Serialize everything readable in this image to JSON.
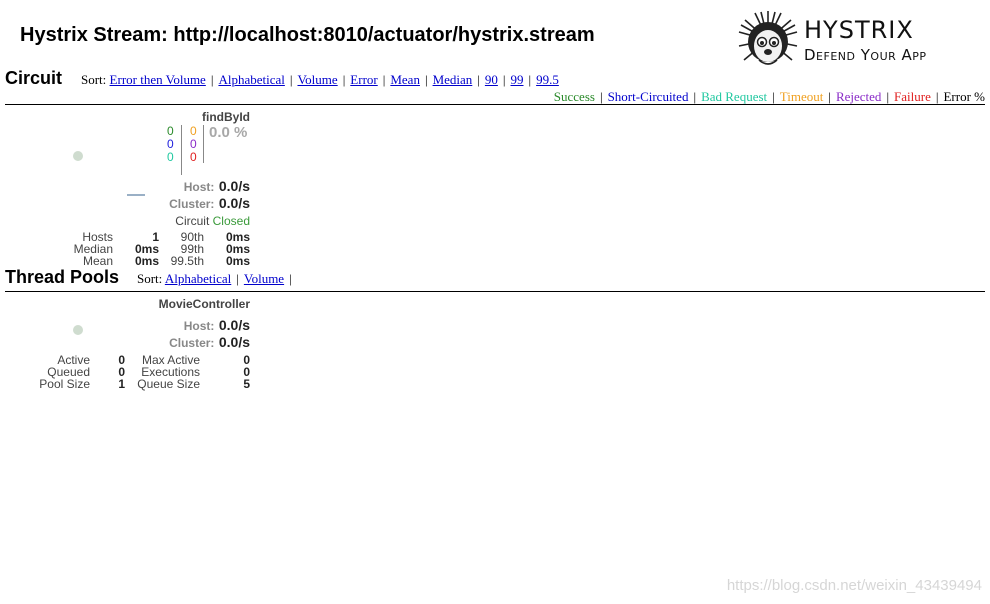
{
  "header": {
    "title": "Hystrix Stream: http://localhost:8010/actuator/hystrix.stream",
    "logo_name": "HYSTRIX",
    "logo_tagline": "Defend Your App"
  },
  "circuit": {
    "heading": "Circuit",
    "sort_label": "Sort:",
    "sort_options": [
      "Error then Volume",
      "Alphabetical",
      "Volume",
      "Error",
      "Mean",
      "Median",
      "90",
      "99",
      "99.5"
    ],
    "legend": [
      {
        "label": "Success",
        "color": "#2a8a2a"
      },
      {
        "label": "Short-Circuited",
        "color": "#0000cc"
      },
      {
        "label": "Bad Request",
        "color": "#20c8a0"
      },
      {
        "label": "Timeout",
        "color": "#f0a020"
      },
      {
        "label": "Rejected",
        "color": "#8a2bc8"
      },
      {
        "label": "Failure",
        "color": "#e02020"
      },
      {
        "label": "Error %",
        "color": "#000000"
      }
    ],
    "monitor": {
      "name": "findById",
      "counts_left": [
        {
          "value": "0",
          "color": "#2a8a2a"
        },
        {
          "value": "0",
          "color": "#2222dd"
        },
        {
          "value": "0",
          "color": "#20c8a0"
        }
      ],
      "counts_right": [
        {
          "value": "0",
          "color": "#f0a020"
        },
        {
          "value": "0",
          "color": "#8a2bc8"
        },
        {
          "value": "0",
          "color": "#e02020"
        }
      ],
      "error_percent": "0.0 %",
      "host_label": "Host:",
      "host_rate": "0.0/s",
      "cluster_label": "Cluster:",
      "cluster_rate": "0.0/s",
      "circuit_label": "Circuit",
      "circuit_status": "Closed",
      "stats": {
        "hosts_label": "Hosts",
        "hosts": "1",
        "median_label": "Median",
        "median": "0ms",
        "mean_label": "Mean",
        "mean": "0ms",
        "p90_label": "90th",
        "p90": "0ms",
        "p99_label": "99th",
        "p99": "0ms",
        "p995_label": "99.5th",
        "p995": "0ms"
      }
    }
  },
  "thread_pools": {
    "heading": "Thread Pools",
    "sort_label": "Sort:",
    "sort_options": [
      "Alphabetical",
      "Volume"
    ],
    "monitor": {
      "name": "MovieController",
      "host_label": "Host:",
      "host_rate": "0.0/s",
      "cluster_label": "Cluster:",
      "cluster_rate": "0.0/s",
      "stats": {
        "active_label": "Active",
        "active": "0",
        "queued_label": "Queued",
        "queued": "0",
        "pool_size_label": "Pool Size",
        "pool_size": "1",
        "max_active_label": "Max Active",
        "max_active": "0",
        "executions_label": "Executions",
        "executions": "0",
        "queue_size_label": "Queue Size",
        "queue_size": "5"
      }
    }
  },
  "watermark": "https://blog.csdn.net/weixin_43439494"
}
